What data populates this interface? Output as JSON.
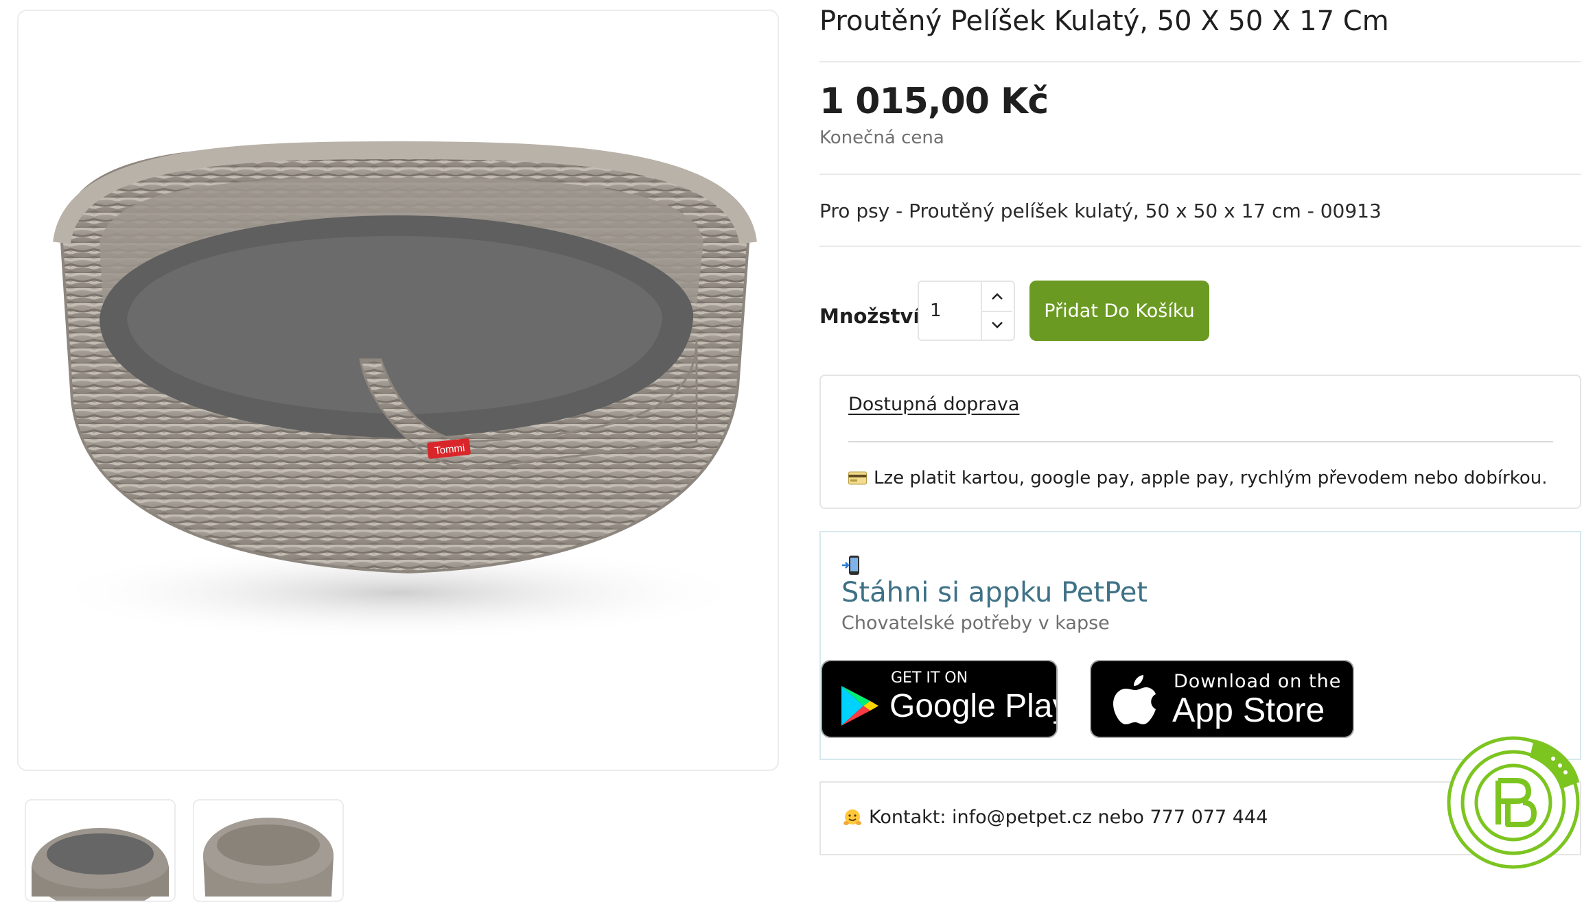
{
  "product": {
    "title": "Proutěný Pelíšek Kulatý, 50 X 50 X 17 Cm",
    "price": "1 015,00 Kč",
    "price_note": "Konečná cena",
    "description": "Pro psy - Proutěný pelíšek kulatý, 50 x 50 x 17 cm - 00913",
    "image_tag": "Tommi"
  },
  "purchase": {
    "quantity_label": "Množství",
    "quantity_value": "1",
    "add_to_cart_label": "Přidat Do Košíku"
  },
  "info": {
    "shipping_link": "Dostupná doprava",
    "payment_text": "Lze platit kartou, google pay, apple pay, rychlým převodem nebo dobírkou."
  },
  "app_promo": {
    "title": "Stáhni si appku PetPet",
    "subtitle": "Chovatelské potřeby v kapse",
    "google_play": {
      "small": "GET IT ON",
      "big": "Google Play"
    },
    "app_store": {
      "small": "Download on the",
      "big": "App Store"
    }
  },
  "contact": {
    "text": "Kontakt: info@petpet.cz nebo 777 077 444"
  },
  "colors": {
    "accent_green": "#6a9a21",
    "app_title_blue": "#3e7186",
    "logo_green": "#7cc520"
  },
  "icons": [
    "chevron-up-icon",
    "chevron-down-icon",
    "credit-card-icon",
    "mobile-phone-arrow-icon",
    "hugging-face-icon",
    "google-play-icon",
    "apple-icon",
    "petpet-logo"
  ]
}
